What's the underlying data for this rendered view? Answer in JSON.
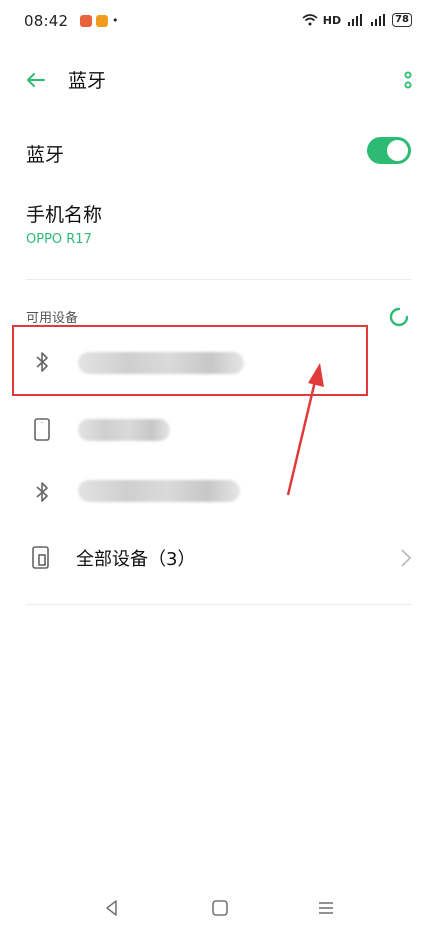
{
  "status_bar": {
    "time": "08:42",
    "network_label": "HD",
    "battery": "78"
  },
  "header": {
    "title": "蓝牙"
  },
  "bluetooth_row": {
    "label": "蓝牙",
    "enabled": true
  },
  "device_name": {
    "label": "手机名称",
    "value": "OPPO R17"
  },
  "available": {
    "section_label": "可用设备"
  },
  "all_devices": {
    "label": "全部设备（3）"
  },
  "colors": {
    "accent": "#2dbb73",
    "highlight": "#e03a3a"
  },
  "icons": [
    "back-arrow-icon",
    "more-dots-icon",
    "bluetooth-icon",
    "phone-icon",
    "all-devices-icon",
    "chevron-right-icon",
    "back-nav-icon",
    "home-nav-icon",
    "menu-nav-icon"
  ]
}
